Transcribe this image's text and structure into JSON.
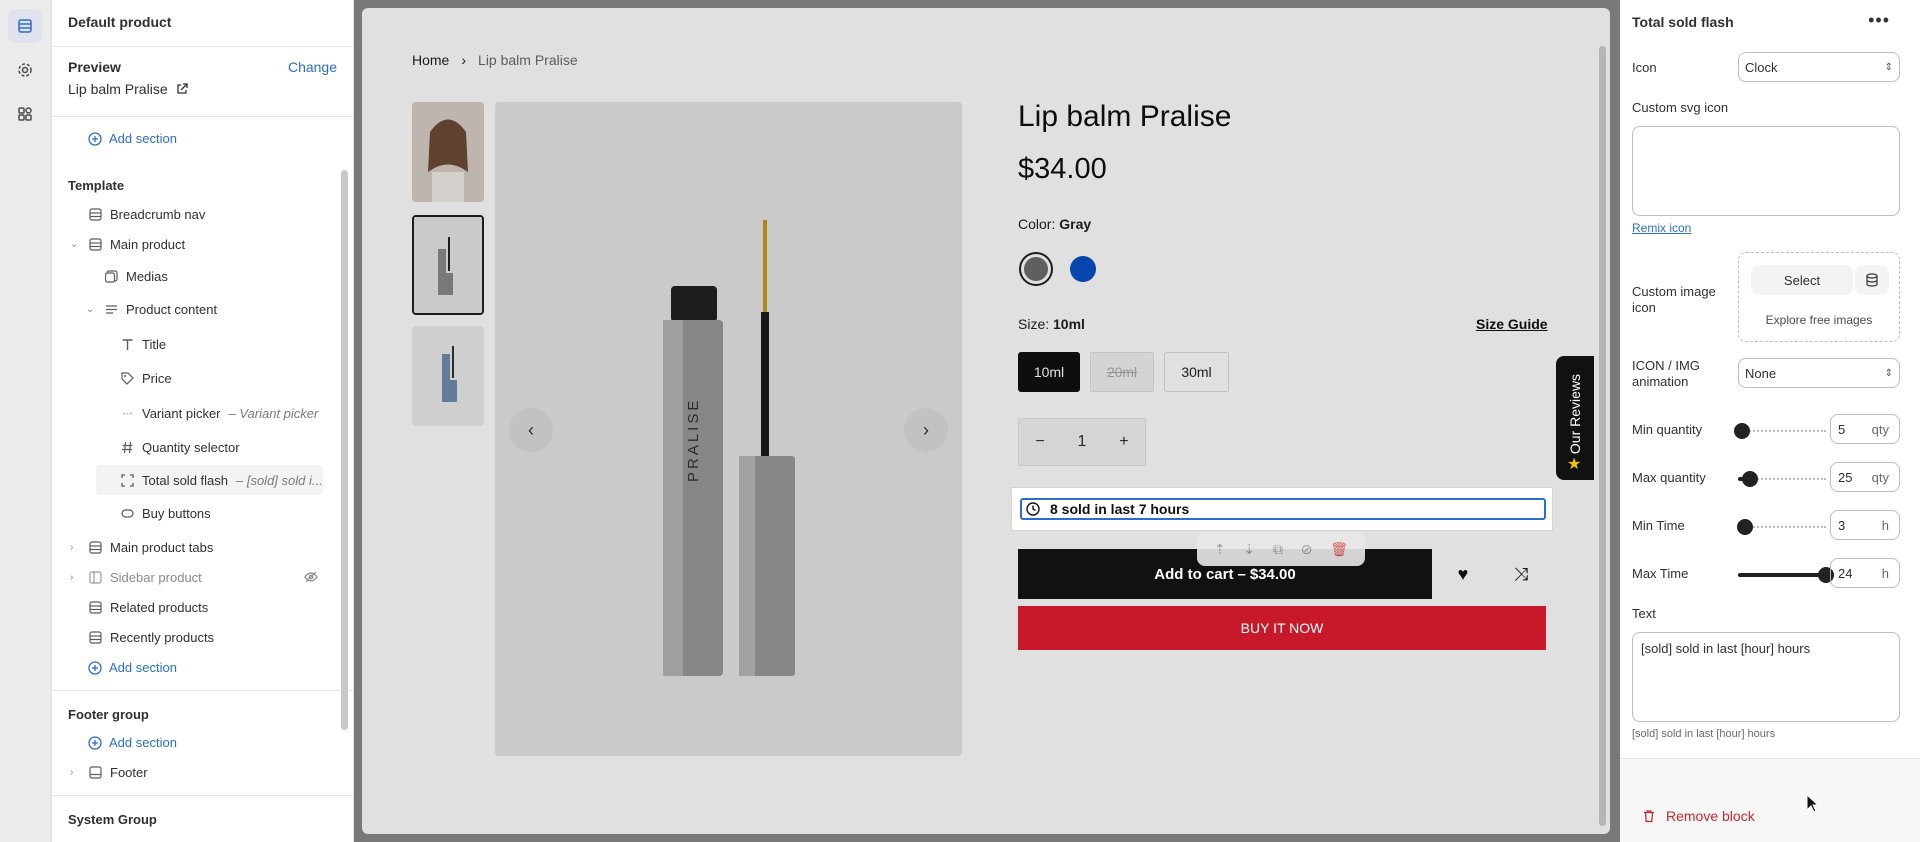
{
  "left_panel": {
    "title": "Default product",
    "preview_label": "Preview",
    "change_label": "Change",
    "preview_value": "Lip balm Pralise",
    "add_section": "Add section",
    "template_title": "Template",
    "tree": {
      "breadcrumb_nav": "Breadcrumb nav",
      "main_product": "Main product",
      "medias": "Medias",
      "product_content": "Product content",
      "title": "Title",
      "price": "Price",
      "variant_picker": "Variant picker",
      "variant_picker_sub": "– Variant picker",
      "quantity_selector": "Quantity selector",
      "total_sold_flash": "Total sold flash",
      "total_sold_flash_sub": "– [sold] sold i...",
      "buy_buttons": "Buy buttons",
      "main_product_tabs": "Main product tabs",
      "sidebar_product": "Sidebar product",
      "related_products": "Related products",
      "recently_products": "Recently products"
    },
    "footer_group_title": "Footer group",
    "footer": "Footer",
    "system_group_title": "System Group"
  },
  "canvas": {
    "breadcrumb": {
      "home": "Home",
      "sep": "›",
      "current": "Lip balm Pralise"
    },
    "product": {
      "title": "Lip balm Pralise",
      "price": "$34.00",
      "color_label": "Color:",
      "color_value": "Gray",
      "size_label": "Size:",
      "size_value": "10ml",
      "size_guide": "Size Guide",
      "sizes": [
        "10ml",
        "20ml",
        "30ml"
      ],
      "quantity": "1",
      "flash_text": "8 sold in last 7 hours",
      "add_to_cart": "Add to cart",
      "add_to_cart_price": "$34.00",
      "buy_now": "BUY IT NOW",
      "brand_on_tube": "PRALISE"
    },
    "reviews_tab": "Our Reviews",
    "colors": {
      "gray": "#6d6d6d",
      "blue": "#0a4fc8",
      "buy_now": "#c8192b"
    }
  },
  "right_panel": {
    "title": "Total sold flash",
    "icon_label": "Icon",
    "icon_value": "Clock",
    "custom_svg_label": "Custom svg icon",
    "remix_link": "Remix icon",
    "custom_image_label": "Custom image icon",
    "select_label": "Select",
    "explore_label": "Explore free images",
    "animation_label": "ICON / IMG animation",
    "animation_value": "None",
    "min_qty_label": "Min quantity",
    "min_qty_value": "5",
    "min_qty_level": 0.05,
    "max_qty_label": "Max quantity",
    "max_qty_value": "25",
    "max_qty_level": 0.14,
    "qty_unit": "qty",
    "min_time_label": "Min Time",
    "min_time_value": "3",
    "min_time_level": 0.08,
    "max_time_label": "Max Time",
    "max_time_value": "24",
    "max_time_level": 1.0,
    "time_unit": "h",
    "text_label": "Text",
    "text_value": "[sold] sold in last [hour] hours",
    "text_help": "[sold] sold in last [hour] hours",
    "remove_block": "Remove block"
  }
}
